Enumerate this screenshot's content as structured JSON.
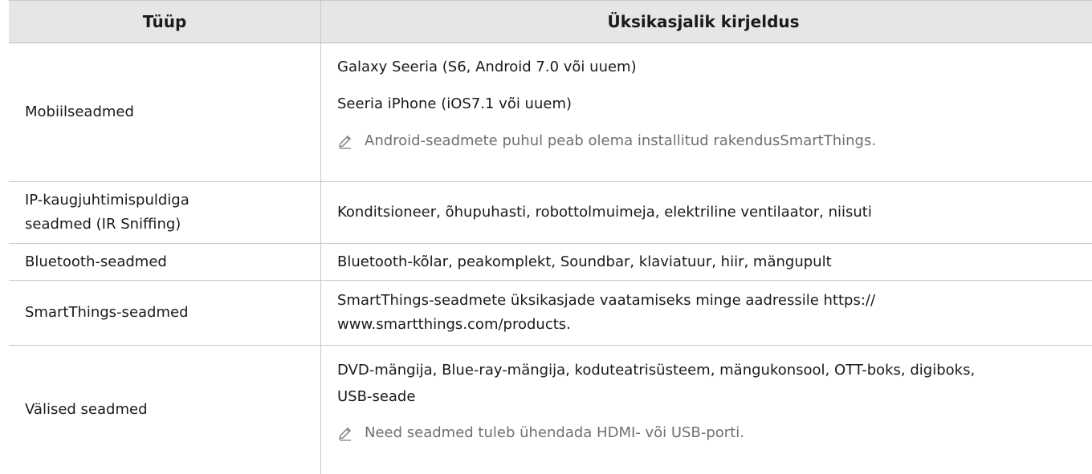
{
  "table": {
    "headers": {
      "type": "Tüüp",
      "description": "Üksikasjalik kirjeldus"
    },
    "rows": [
      {
        "type": "Mobiilseadmed",
        "lines": [
          "Galaxy Seeria (S6, Android 7.0 või uuem)",
          "Seeria iPhone (iOS7.1 või uuem)"
        ],
        "note": "Android-seadmete puhul peab olema installitud rakendusSmartThings."
      },
      {
        "type_lines": [
          "IP-kaugjuhtimispuldiga",
          "seadmed (IR Sniffing)"
        ],
        "lines": [
          "Konditsioneer, õhupuhasti, robottolmuimeja, elektriline ventilaator, niisuti"
        ]
      },
      {
        "type": "Bluetooth-seadmed",
        "lines": [
          "Bluetooth-kõlar, peakomplekt, Soundbar, klaviatuur, hiir, mängupult"
        ]
      },
      {
        "type": "SmartThings-seadmed",
        "lines": [
          "SmartThings-seadmete üksikasjade vaatamiseks minge aadressile https://",
          "www.smartthings.com/products."
        ]
      },
      {
        "type": "Välised seadmed",
        "lines": [
          "DVD-mängija, Blue-ray-mängija, koduteatrisüsteem, mängukonsool, OTT-boks, digiboks,",
          "USB-seade"
        ],
        "note": "Need seadmed tuleb ühendada HDMI- või USB-porti."
      }
    ]
  },
  "icons": {
    "note": "pencil-note-icon"
  }
}
